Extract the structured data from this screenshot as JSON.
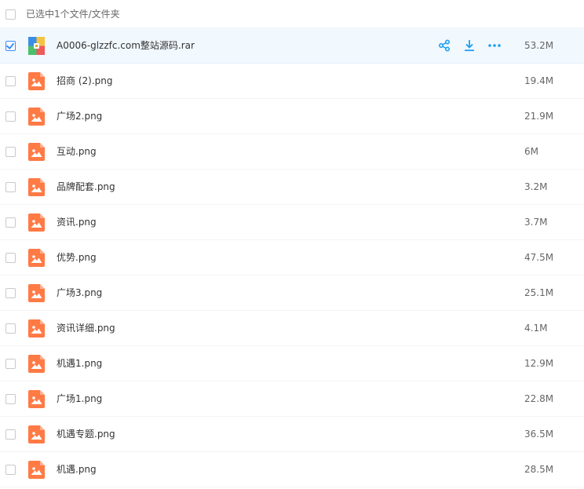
{
  "header": {
    "selection_label": "已选中1个文件/文件夹"
  },
  "colors": {
    "accent": "#3b8cff",
    "action_icon": "#1e9ff0",
    "image_icon": "#ff7a45",
    "selected_row_bg": "#f1f8fe"
  },
  "selected_actions": [
    {
      "name": "share",
      "icon": "share-icon"
    },
    {
      "name": "download",
      "icon": "download-icon"
    },
    {
      "name": "more",
      "icon": "more-icon"
    }
  ],
  "files": [
    {
      "name": "A0006-glzzfc.com整站源码.rar",
      "size": "53.2M",
      "type": "archive",
      "selected": true
    },
    {
      "name": "招商 (2).png",
      "size": "19.4M",
      "type": "image",
      "selected": false
    },
    {
      "name": "广场2.png",
      "size": "21.9M",
      "type": "image",
      "selected": false
    },
    {
      "name": "互动.png",
      "size": "6M",
      "type": "image",
      "selected": false
    },
    {
      "name": "品牌配套.png",
      "size": "3.2M",
      "type": "image",
      "selected": false
    },
    {
      "name": "资讯.png",
      "size": "3.7M",
      "type": "image",
      "selected": false
    },
    {
      "name": "优势.png",
      "size": "47.5M",
      "type": "image",
      "selected": false
    },
    {
      "name": "广场3.png",
      "size": "25.1M",
      "type": "image",
      "selected": false
    },
    {
      "name": "资讯详细.png",
      "size": "4.1M",
      "type": "image",
      "selected": false
    },
    {
      "name": "机遇1.png",
      "size": "12.9M",
      "type": "image",
      "selected": false
    },
    {
      "name": "广场1.png",
      "size": "22.8M",
      "type": "image",
      "selected": false
    },
    {
      "name": "机遇专题.png",
      "size": "36.5M",
      "type": "image",
      "selected": false
    },
    {
      "name": "机遇.png",
      "size": "28.5M",
      "type": "image",
      "selected": false
    }
  ]
}
